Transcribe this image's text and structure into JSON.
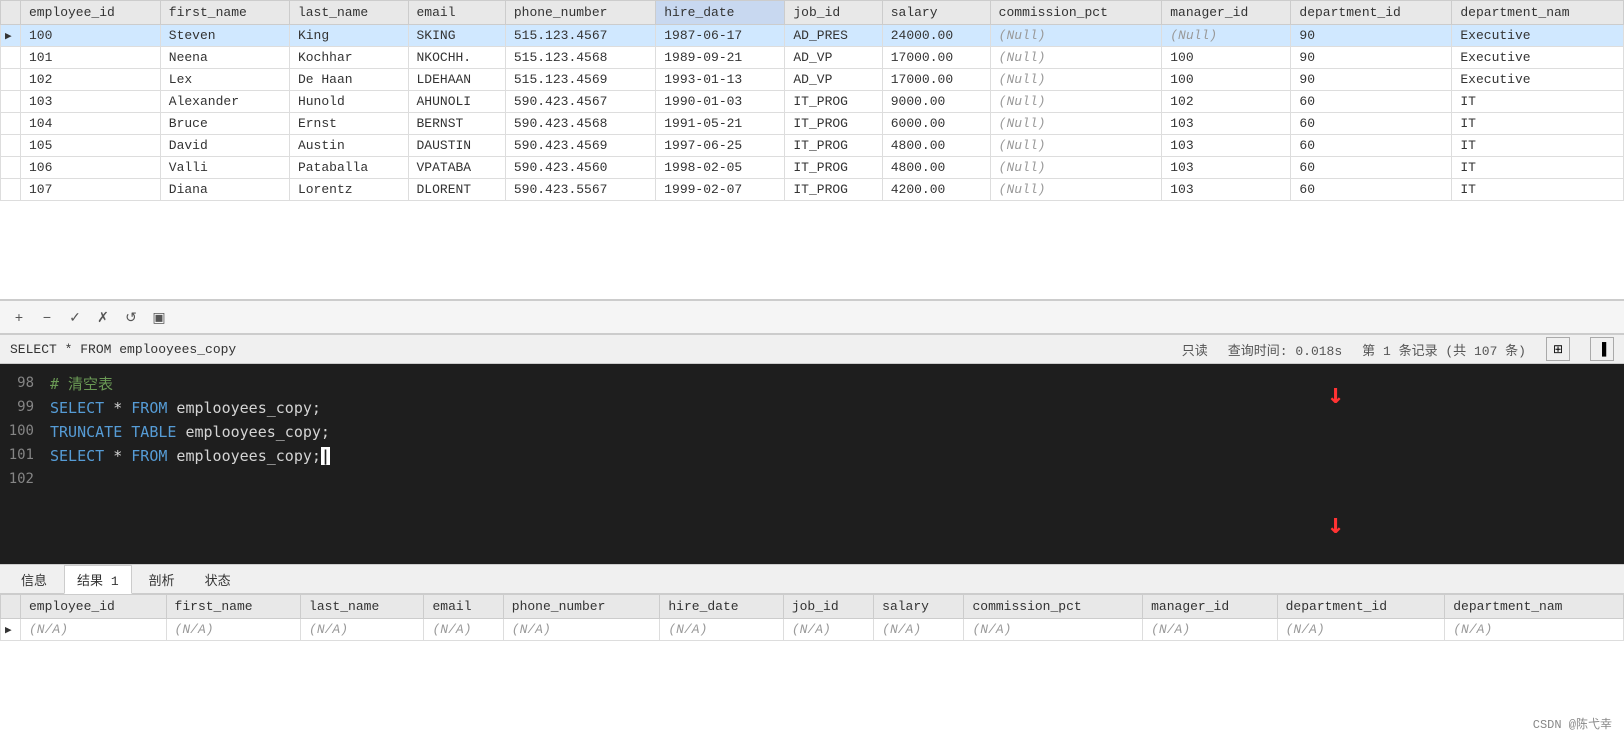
{
  "topTable": {
    "columns": [
      "employee_id",
      "first_name",
      "last_name",
      "email",
      "phone_number",
      "hire_date",
      "job_id",
      "salary",
      "commission_pct",
      "manager_id",
      "department_id",
      "department_nam"
    ],
    "sortedColumn": "hire_date",
    "rows": [
      {
        "indicator": "▶",
        "employee_id": "100",
        "first_name": "Steven",
        "last_name": "King",
        "email": "SKING",
        "phone_number": "515.123.4567",
        "hire_date": "1987-06-17",
        "job_id": "AD_PRES",
        "salary": "24000.00",
        "commission_pct": "(Null)",
        "manager_id": "(Null)",
        "department_id": "90",
        "department_nam": "Executive"
      },
      {
        "indicator": "",
        "employee_id": "101",
        "first_name": "Neena",
        "last_name": "Kochhar",
        "email": "NKOCHH.",
        "phone_number": "515.123.4568",
        "hire_date": "1989-09-21",
        "job_id": "AD_VP",
        "salary": "17000.00",
        "commission_pct": "(Null)",
        "manager_id": "100",
        "department_id": "90",
        "department_nam": "Executive"
      },
      {
        "indicator": "",
        "employee_id": "102",
        "first_name": "Lex",
        "last_name": "De Haan",
        "email": "LDEHAAN",
        "phone_number": "515.123.4569",
        "hire_date": "1993-01-13",
        "job_id": "AD_VP",
        "salary": "17000.00",
        "commission_pct": "(Null)",
        "manager_id": "100",
        "department_id": "90",
        "department_nam": "Executive"
      },
      {
        "indicator": "",
        "employee_id": "103",
        "first_name": "Alexander",
        "last_name": "Hunold",
        "email": "AHUNOLI",
        "phone_number": "590.423.4567",
        "hire_date": "1990-01-03",
        "job_id": "IT_PROG",
        "salary": "9000.00",
        "commission_pct": "(Null)",
        "manager_id": "102",
        "department_id": "60",
        "department_nam": "IT"
      },
      {
        "indicator": "",
        "employee_id": "104",
        "first_name": "Bruce",
        "last_name": "Ernst",
        "email": "BERNST",
        "phone_number": "590.423.4568",
        "hire_date": "1991-05-21",
        "job_id": "IT_PROG",
        "salary": "6000.00",
        "commission_pct": "(Null)",
        "manager_id": "103",
        "department_id": "60",
        "department_nam": "IT"
      },
      {
        "indicator": "",
        "employee_id": "105",
        "first_name": "David",
        "last_name": "Austin",
        "email": "DAUSTIN",
        "phone_number": "590.423.4569",
        "hire_date": "1997-06-25",
        "job_id": "IT_PROG",
        "salary": "4800.00",
        "commission_pct": "(Null)",
        "manager_id": "103",
        "department_id": "60",
        "department_nam": "IT"
      },
      {
        "indicator": "",
        "employee_id": "106",
        "first_name": "Valli",
        "last_name": "Pataballa",
        "email": "VPATABA",
        "phone_number": "590.423.4560",
        "hire_date": "1998-02-05",
        "job_id": "IT_PROG",
        "salary": "4800.00",
        "commission_pct": "(Null)",
        "manager_id": "103",
        "department_id": "60",
        "department_nam": "IT"
      },
      {
        "indicator": "",
        "employee_id": "107",
        "first_name": "Diana",
        "last_name": "Lorentz",
        "email": "DLORENT",
        "phone_number": "590.423.5567",
        "hire_date": "1999-02-07",
        "job_id": "IT_PROG",
        "salary": "4200.00",
        "commission_pct": "(Null)",
        "manager_id": "103",
        "department_id": "60",
        "department_nam": "IT"
      }
    ]
  },
  "toolbar": {
    "buttons": [
      "+",
      "−",
      "✓",
      "✗",
      "↺",
      "▣"
    ]
  },
  "statusBar": {
    "query": "SELECT * FROM emplooyees_copy",
    "readonly": "只读",
    "queryTime": "查询时间: 0.018s",
    "recordInfo": "第 1 条记录 (共 107 条)"
  },
  "sqlEditor": {
    "lines": [
      {
        "num": "98",
        "type": "comment",
        "content": "#  清空表"
      },
      {
        "num": "99",
        "type": "select",
        "content": "SELECT * FROM emplooyees_copy;"
      },
      {
        "num": "100",
        "type": "truncate",
        "content": "TRUNCATE TABLE emplooyees_copy;"
      },
      {
        "num": "101",
        "type": "select_cursor",
        "content": "SELECT * FROM emplooyees_copy;"
      },
      {
        "num": "102",
        "type": "empty",
        "content": ""
      }
    ]
  },
  "bottomTabs": {
    "tabs": [
      "信息",
      "结果 1",
      "剖析",
      "状态"
    ],
    "activeTab": "结果 1"
  },
  "bottomTable": {
    "columns": [
      "employee_id",
      "first_name",
      "last_name",
      "email",
      "phone_number",
      "hire_date",
      "job_id",
      "salary",
      "commission_pct",
      "manager_id",
      "department_id",
      "department_nam"
    ],
    "rows": [
      {
        "indicator": "▶",
        "employee_id": "(N/A)",
        "first_name": "(N/A)",
        "last_name": "(N/A)",
        "email": "(N/A)",
        "phone_number": "(N/A)",
        "hire_date": "(N/A)",
        "job_id": "(N/A)",
        "salary": "(N/A)",
        "commission_pct": "(N/A)",
        "manager_id": "(N/A)",
        "department_id": "(N/A)",
        "department_nam": "(N/A)"
      }
    ]
  },
  "watermark": "CSDN @陈弋幸"
}
